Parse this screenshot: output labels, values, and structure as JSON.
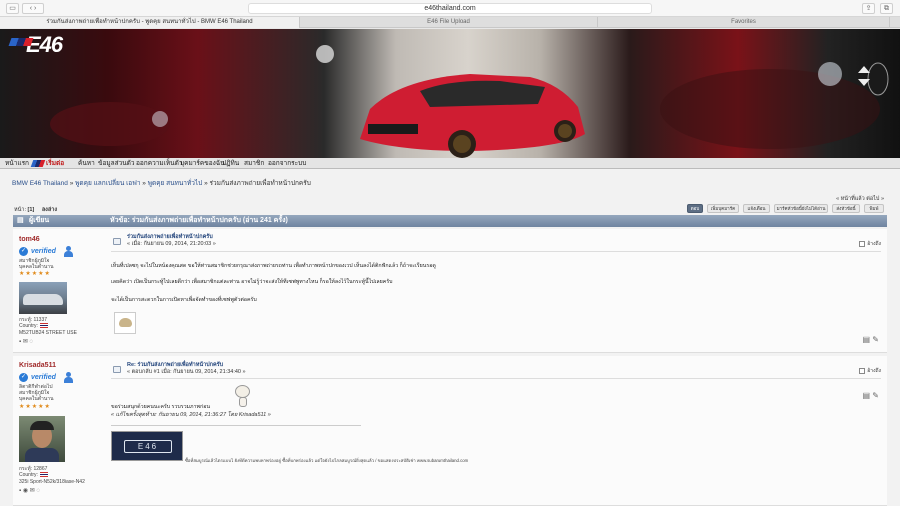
{
  "browser": {
    "url": "e46thailand.com",
    "tabs": [
      {
        "label": "ร่วมกันส่งภาพถ่ายเพื่อทำหน้าปกครับ - พูดคุย สนทนาทั่วไป - BMW E46 Thailand",
        "active": true
      },
      {
        "label": "E46 File Upload",
        "active": false
      },
      {
        "label": "Favorites",
        "active": false
      }
    ]
  },
  "banner": {
    "logo_text": "E46"
  },
  "nav": {
    "items": [
      "หน้าแรก",
      "เริ่มต่อ",
      "ค้นหา",
      "ข้อมูลส่วนตัว",
      "ออกความเห็นตัว",
      "บุคมาร์คของฉัน",
      "ปฏิทิน",
      "สมาชิก",
      "ออกจากระบบ"
    ]
  },
  "breadcrumb": [
    "BMW E46 Thailand",
    "พูดคุย แลกเปลี่ยน เอฟา",
    "พูดคุย สนทนาทั่วไป",
    "ร่วมกันส่งภาพถ่ายเพื่อทำหน้าปกครับ"
  ],
  "page_tools": "« หน้าที่แล้ว ต่อไป »",
  "pages": {
    "label": "หน้า:",
    "current": "[1]",
    "all": "ลงล่าง"
  },
  "buttons": [
    "ตอบ",
    "เพิ่มบุคมาร์ค",
    "แจ้งเตือน",
    "มาร์คหัวข้อนี้ยังไม่ได้อ่าน",
    "ส่งหัวข้อนี้",
    "พิมพ์"
  ],
  "thread_header": {
    "author_col": "ผู้เขียน",
    "topic": "หัวข้อ: ร่วมกันส่งภาพถ่ายเพื่อทำหน้าปกครับ  (อ่าน 241 ครั้ง)"
  },
  "posts": [
    {
      "username": "tom46",
      "verified": "verified",
      "rank_line1": "สมาชิกผู้ภูมิใจ",
      "rank_line2": "บุคคลในตำนาน",
      "stars": "★★★★★",
      "posts_count": "กระทู้: 11337",
      "country": "Country:",
      "signature_tag": "M52TUB24 STREET USE",
      "title": "ร่วมกันส่งภาพถ่ายเพื่อทำหน้าปกครับ",
      "meta": "« เมื่อ: กันยายน 09, 2014, 21:20:03 »",
      "quote_label": "อ้างถึง",
      "lines": [
        "เห็นที่เปลซกุ จะไปในหน้องคุณสด ขอให้ท่านสมาชิกช่วยกรุณาส่งภาพถ่ายรถท่าน เพื่อทำภาพหน้าปกของเวป เห็นลงได้ติกฟักแล้ว ก็ถ้าจะเรียนรอดู",
        "เลยคิดว่า เปิดเป็นกระทู้ไปเลยดีกว่า เพื่อสมาชิกแต่ละท่าน อาจไม่รู้ว่าจะส่งให้ทีเซฟพูทางไหน ก็รอให้ลงไว้ในกระทู้นี้ไปเลยครับ",
        "จะได้เป็นการสะดวกในการเปิดหาเพื่อจัดทำของที่เซฟพูตัวต่อครับ"
      ]
    },
    {
      "username": "Krisada511",
      "verified": "verified",
      "rank_line1": "ลิตาติกีฬาต่อไป",
      "rank_line2": "สมาชิกผู้ภูมิใจ",
      "rank_line3": "บุคคลในตำนาน",
      "stars": "★★★★★",
      "posts_count": "กระทู้: 12867",
      "country": "Country:",
      "signature_tag": "325i Sport-N52k/318iase-N42",
      "title": "Re: ร่วมกันส่งภาพถ่ายเพื่อทำหน้าปกครับ",
      "meta": "« ตอบกลับ #1 เมื่อ: กันยายน 09, 2014, 21:34:40 »",
      "quote_label": "อ้างถึง",
      "lines": [
        "ขอร่วมสนุกด้วยคนนะครับ รวบรวมภาพก่อน"
      ],
      "edited": "« แก้ไขครั้งสุดท้าย: กันยายน 09, 2014, 21:36:27 โดย Krisada511 »",
      "sig_image_text": "E46",
      "sig_line": "ซื้อที่สมบูรณ์แล้วไตรแบบไ ยังทีดีความพบหาพร่องอยู่ ซื้อที่บกพร่องแล้ว แต่ใจยังไปไกลสมบูรณ์ยิ่งสุดแล้ว / ขอแสดงประสบัติเช่า www.subarumthailand.com"
    }
  ],
  "colors": {
    "accent": "#6f84a0",
    "username": "#a02a2a",
    "link": "#23457c",
    "verified": "#2b7bd6"
  }
}
